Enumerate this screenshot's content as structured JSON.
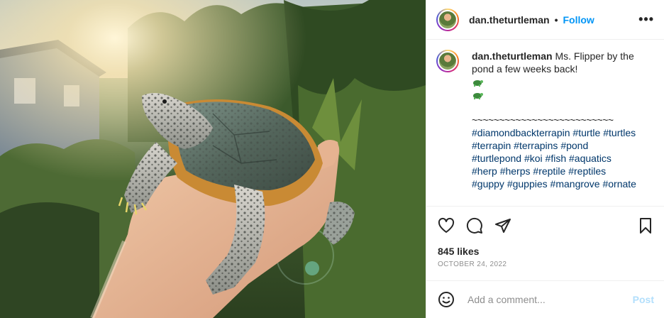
{
  "post": {
    "username": "dan.theturtleman",
    "separator": "•",
    "follow_label": "Follow",
    "more_icon": "more-options-icon",
    "caption_text": "Ms. Flipper by the pond a few weeks back!",
    "emoji": [
      "turtle-emoji",
      "turtle-emoji"
    ],
    "divider_line": "~~~~~~~~~~~~~~~~~~~~~~~~~~",
    "hashtags": [
      "#diamondbackterrapin",
      "#turtle",
      "#turtles",
      "#terrapin",
      "#terrapins",
      "#pond",
      "#turtlepond",
      "#koi",
      "#fish",
      "#aquatics",
      "#herp",
      "#herps",
      "#reptile",
      "#reptiles",
      "#guppy",
      "#guppies",
      "#mangrove",
      "#ornate"
    ],
    "likes": "845 likes",
    "date": "OCTOBER 24, 2022",
    "comment_placeholder": "Add a comment...",
    "post_label": "Post",
    "icons": [
      "heart-icon",
      "comment-icon",
      "share-icon",
      "bookmark-icon",
      "emoji-icon"
    ],
    "colors": {
      "link": "#0095f6",
      "hashtag": "#00376b",
      "muted": "#8e8e8e",
      "post_disabled": "#b2dffc"
    }
  }
}
